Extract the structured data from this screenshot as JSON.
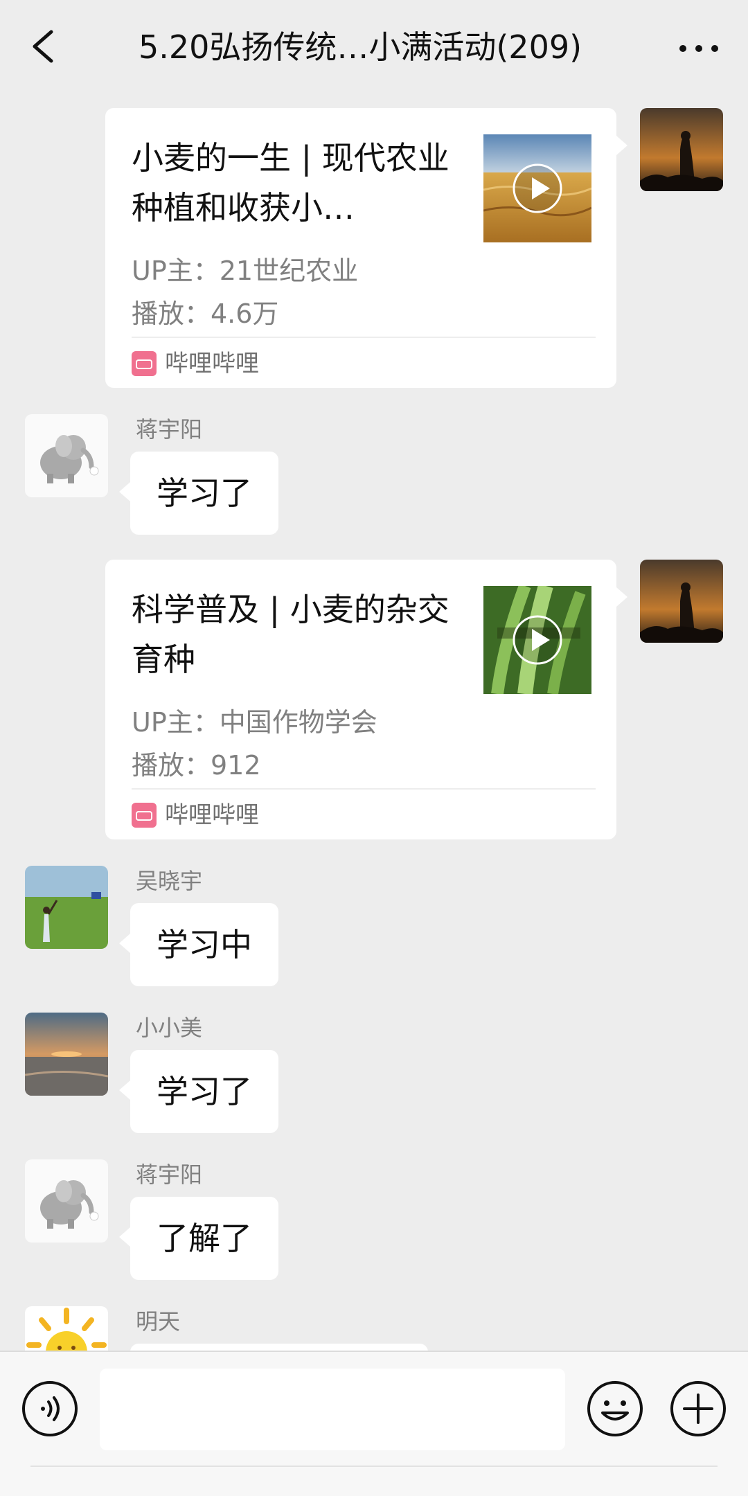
{
  "header": {
    "title": "5.20弘扬传统…小满活动(209)",
    "back_icon": "chevron-left-icon",
    "more_icon": "ellipsis-icon"
  },
  "messages": [
    {
      "type": "link-card",
      "side": "right",
      "title": "小麦的一生 | 现代农业种植和收获小…",
      "uploader": "UP主：21世纪农业",
      "plays": "播放：4.6万",
      "source": "哔哩哔哩",
      "thumb": "wheat-field-video-thumbnail"
    },
    {
      "type": "text",
      "side": "left",
      "sender": "蒋宇阳",
      "text": "学习了",
      "avatar": "elephant-avatar"
    },
    {
      "type": "link-card",
      "side": "right",
      "title": "科学普及 | 小麦的杂交育种",
      "uploader": "UP主：中国作物学会",
      "plays": "播放：912",
      "source": "哔哩哔哩",
      "thumb": "wheat-flower-video-thumbnail"
    },
    {
      "type": "text",
      "side": "left",
      "sender": "吴晓宇",
      "text": "学习中",
      "avatar": "grassland-avatar"
    },
    {
      "type": "text",
      "side": "left",
      "sender": "小小美",
      "text": "学习了",
      "avatar": "beach-sunset-avatar"
    },
    {
      "type": "text",
      "side": "left",
      "sender": "蒋宇阳",
      "text": "了解了",
      "avatar": "elephant-avatar"
    },
    {
      "type": "text",
      "side": "left",
      "sender": "明天",
      "text": "",
      "avatar": "sun-avatar"
    }
  ],
  "input_bar": {
    "voice_icon": "voice-icon",
    "emoji_icon": "emoji-icon",
    "plus_icon": "plus-icon",
    "input_value": ""
  },
  "colors": {
    "background": "#ededed",
    "bubble": "#ffffff",
    "bilibili": "#f0708f",
    "name_gray": "#808080"
  }
}
